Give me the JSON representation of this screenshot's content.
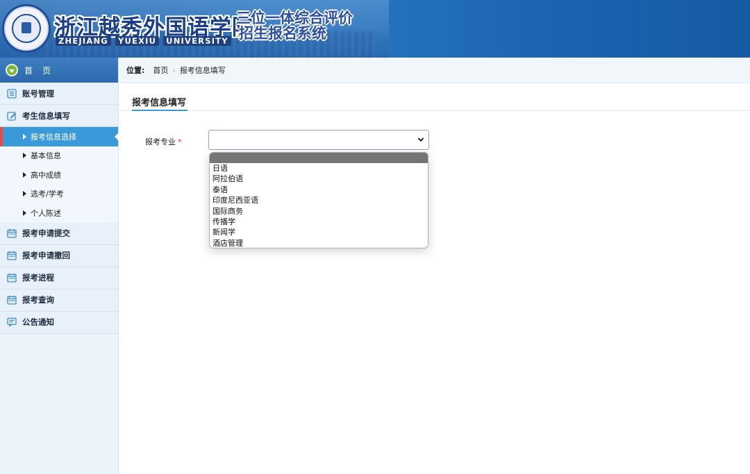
{
  "header": {
    "school_name_cn": "浙江越秀外国语学院",
    "school_name_en": [
      "ZHEJIANG",
      "YUEXIU",
      "UNIVERSITY"
    ],
    "system_title_line1": "三位一体综合评价",
    "system_title_line2": "招生报名系统"
  },
  "sidebar": {
    "home_label": "首页",
    "items": [
      {
        "label": "账号管理",
        "icon": "list-icon"
      },
      {
        "label": "考生信息填写",
        "icon": "edit-icon"
      },
      {
        "label": "报考申请提交",
        "icon": "calendar-icon"
      },
      {
        "label": "报考申请撤回",
        "icon": "calendar-icon"
      },
      {
        "label": "报考进程",
        "icon": "calendar-icon"
      },
      {
        "label": "报考查询",
        "icon": "calendar-icon"
      },
      {
        "label": "公告通知",
        "icon": "message-icon"
      }
    ],
    "sub_items": [
      "报考信息选择",
      "基本信息",
      "高中成绩",
      "选考/学考",
      "个人陈述"
    ],
    "active_sub_item": "报考信息选择"
  },
  "breadcrumb": {
    "prefix": "位置:",
    "home": "首页",
    "current": "报考信息填写"
  },
  "section": {
    "title": "报考信息填写"
  },
  "form": {
    "major_label": "报考专业",
    "required_mark": "*",
    "major_value": "",
    "options": [
      "",
      "日语",
      "阿拉伯语",
      "泰语",
      "印度尼西亚语",
      "国际商务",
      "传播学",
      "新闻学",
      "酒店管理"
    ]
  },
  "colors": {
    "accent": "#3a9ad9",
    "active_marker": "#e84a4a",
    "header_blue": "#1f5fa8",
    "required": "#e03131"
  }
}
